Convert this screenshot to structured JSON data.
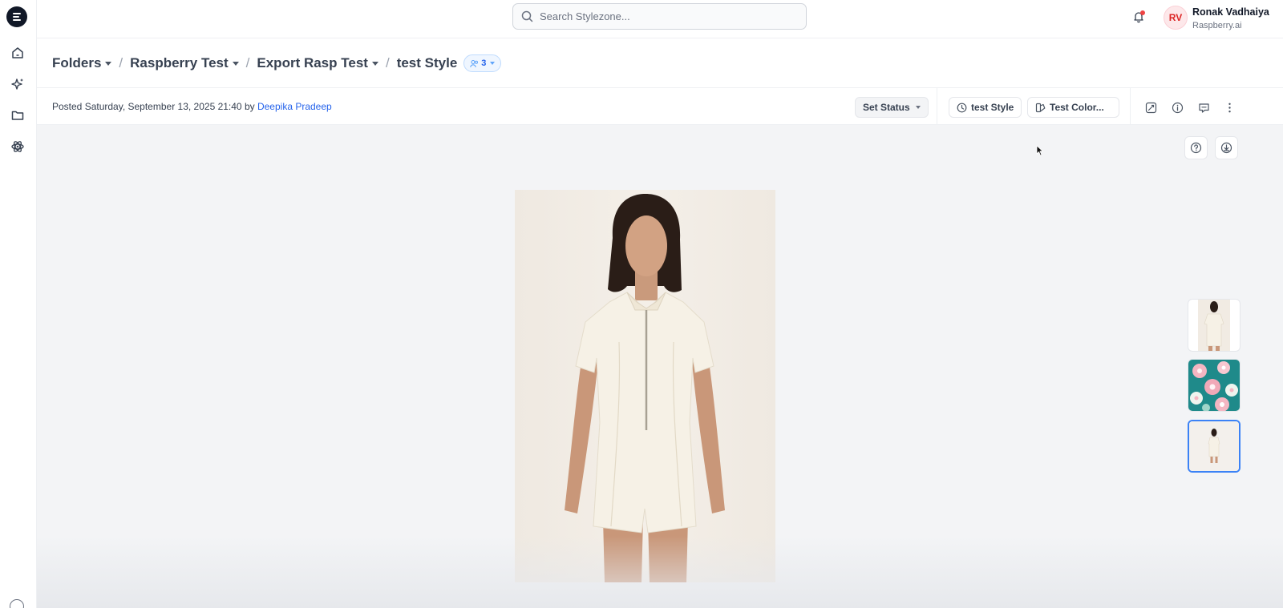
{
  "topbar": {
    "search_placeholder": "Search Stylezone...",
    "user": {
      "initials": "RV",
      "name": "Ronak Vadhaiya",
      "org": "Raspberry.ai"
    }
  },
  "breadcrumb": {
    "items": [
      {
        "label": "Folders"
      },
      {
        "label": "Raspberry Test"
      },
      {
        "label": "Export Rasp Test"
      }
    ],
    "current": "test Style",
    "share_count": "3"
  },
  "post_info": {
    "prefix": "Posted Saturday, September 13, 2025 21:40 by",
    "author": "Deepika Pradeep"
  },
  "toolbar": {
    "set_status_label": "Set Status",
    "style_chip_label": "test Style",
    "color_chip_label": "Test Color..."
  },
  "colors": {
    "accent": "#2563eb",
    "notification_dot": "#ef4444",
    "avatar_text": "#dc2626",
    "selected_thumb_border": "#3b82f6",
    "canvas_bg": "#f3f4f6"
  },
  "thumbnails": [
    {
      "kind": "model-photo"
    },
    {
      "kind": "floral-print"
    },
    {
      "kind": "model-photo-small",
      "selected": true
    }
  ]
}
